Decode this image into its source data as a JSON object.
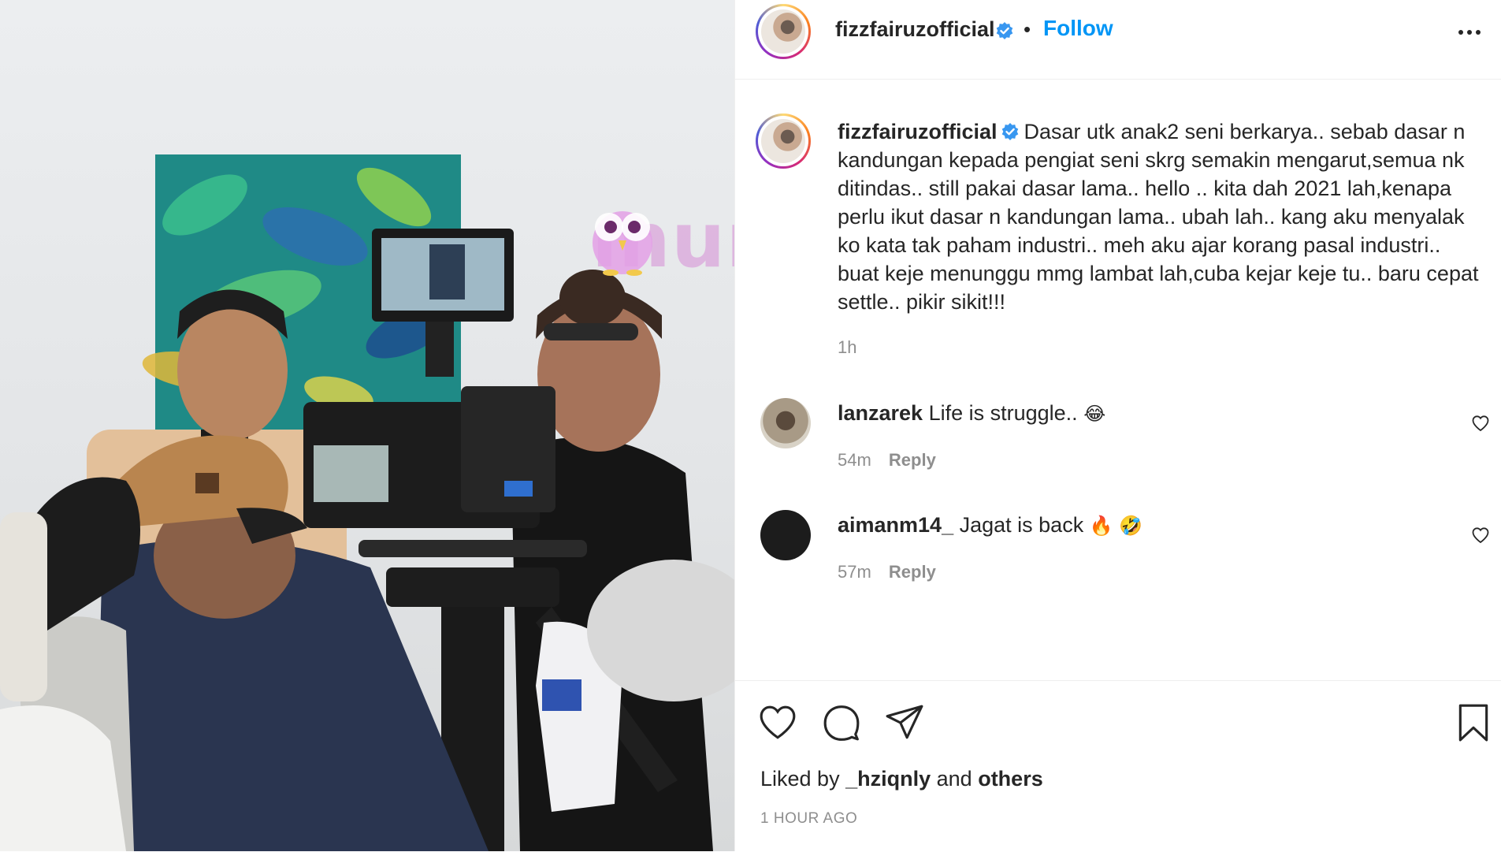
{
  "photo": {
    "alt_label": ""
  },
  "watermark": {
    "text": "murai"
  },
  "header": {
    "username": "fizzfairuzofficial",
    "separator": "•",
    "follow_label": "Follow"
  },
  "caption": {
    "username": "fizzfairuzofficial",
    "text": "Dasar utk anak2 seni berkarya.. sebab dasar n kandungan kepada pengiat seni skrg semakin mengarut,semua nk ditindas.. still pakai dasar lama.. hello .. kita dah 2021 lah,kenapa perlu ikut dasar n kandungan lama.. ubah lah.. kang aku menyalak ko kata tak paham industri.. meh aku ajar korang pasal industri.. buat keje menunggu mmg lambat lah,cuba kejar keje tu.. baru cepat settle.. pikir sikit!!!",
    "time": "1h"
  },
  "comments": [
    {
      "username": "lanzarek",
      "text": "Life is struggle..",
      "emoji": "😂",
      "time": "54m",
      "reply_label": "Reply"
    },
    {
      "username": "aimanm14_",
      "text": "Jagat is back",
      "emoji": "🔥 🤣",
      "time": "57m",
      "reply_label": "Reply"
    }
  ],
  "likes": {
    "prefix": "Liked by",
    "user": "_hziqnly",
    "conjunction": "and",
    "others": "others"
  },
  "post_time": "1 HOUR AGO",
  "colors": {
    "link_blue": "#0095f6",
    "text": "#262626",
    "muted": "#8e8e8e",
    "verified": "#3897f0"
  }
}
